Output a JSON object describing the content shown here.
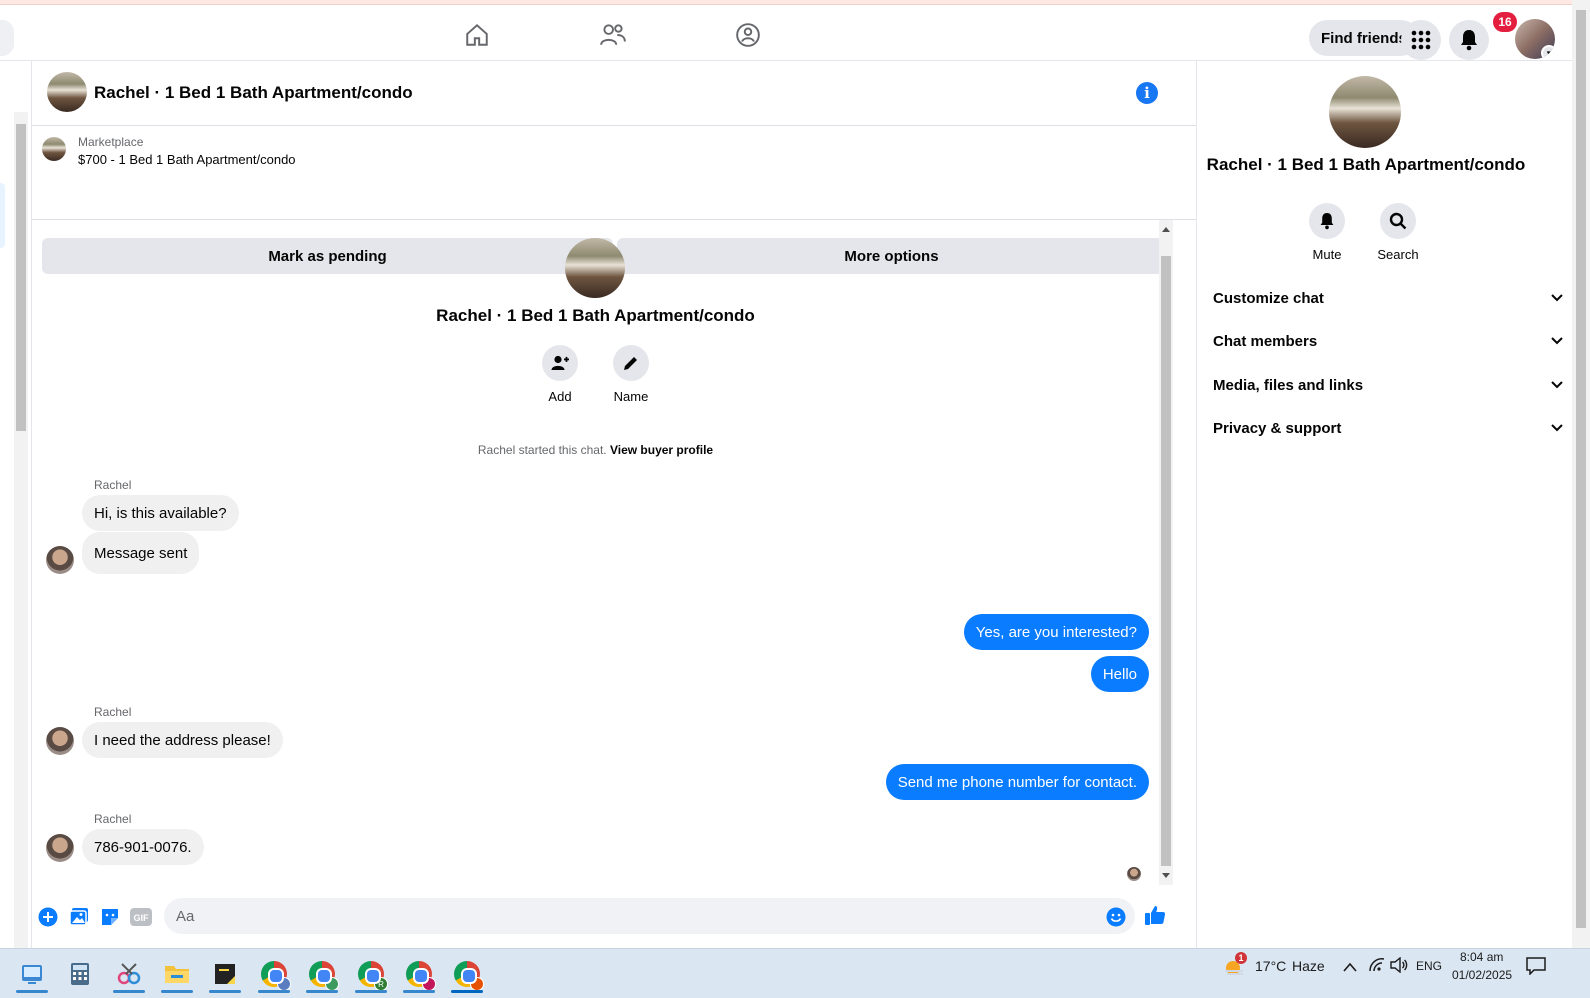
{
  "topbar": {
    "find_friends_label": "Find friends",
    "notification_count": "16",
    "nav_icons": [
      "home-icon",
      "friends-icon",
      "groups-icon"
    ]
  },
  "chat_header": {
    "title": "Rachel · 1 Bed 1 Bath Apartment/condo",
    "info_glyph": "i"
  },
  "marketplace": {
    "label": "Marketplace",
    "listing": "$700 - 1 Bed 1 Bath Apartment/condo",
    "mark_pending_label": "Mark as pending",
    "more_options_label": "More options"
  },
  "thread": {
    "title": "Rachel · 1 Bed 1 Bath Apartment/condo",
    "add_label": "Add",
    "name_label": "Name",
    "started_text": "Rachel started this chat.",
    "view_buyer_profile": "View buyer profile",
    "messages": [
      {
        "sender": "Rachel",
        "text": "Hi, is this available?",
        "direction": "in"
      },
      {
        "sender": "",
        "text": "Message sent",
        "direction": "in"
      },
      {
        "sender": "",
        "text": "Yes, are you interested?",
        "direction": "out"
      },
      {
        "sender": "",
        "text": "Hello",
        "direction": "out"
      },
      {
        "sender": "Rachel",
        "text": "I need the address please!",
        "direction": "in"
      },
      {
        "sender": "",
        "text": "Send me phone number for contact.",
        "direction": "out"
      },
      {
        "sender": "Rachel",
        "text": "786-901-0076.",
        "direction": "in"
      }
    ]
  },
  "composer": {
    "placeholder": "Aa",
    "gif_label": "GIF"
  },
  "right_panel": {
    "title": "Rachel · 1 Bed 1 Bath Apartment/condo",
    "mute_label": "Mute",
    "search_label": "Search",
    "sections": [
      "Customize chat",
      "Chat members",
      "Media, files and links",
      "Privacy & support"
    ]
  },
  "taskbar": {
    "weather_temp": "17°C",
    "weather_desc": "Haze",
    "weather_alert": "1",
    "language": "ENG",
    "time": "8:04 am",
    "date": "01/02/2025",
    "profile_badge": "R"
  },
  "colors": {
    "accent": "#1877f2",
    "outgoing_bubble": "#0a7cff",
    "incoming_bubble": "#f0f0f0",
    "badge": "#e41e3f"
  }
}
